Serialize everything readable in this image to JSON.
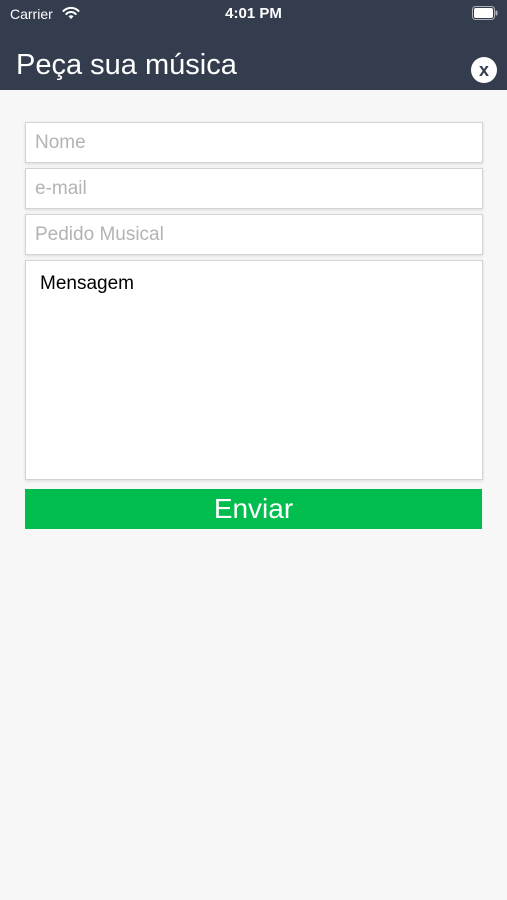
{
  "status_bar": {
    "carrier": "Carrier",
    "time": "4:01 PM",
    "wifi_icon": "wifi-icon",
    "battery_icon": "battery-icon"
  },
  "header": {
    "title": "Peça sua música",
    "close_label": "x",
    "background_color": "#343d4e"
  },
  "form": {
    "name_placeholder": "Nome",
    "email_placeholder": "e-mail",
    "request_placeholder": "Pedido Musical",
    "message_placeholder": "Mensagem",
    "submit_label": "Enviar",
    "submit_color": "#00bd4d"
  }
}
